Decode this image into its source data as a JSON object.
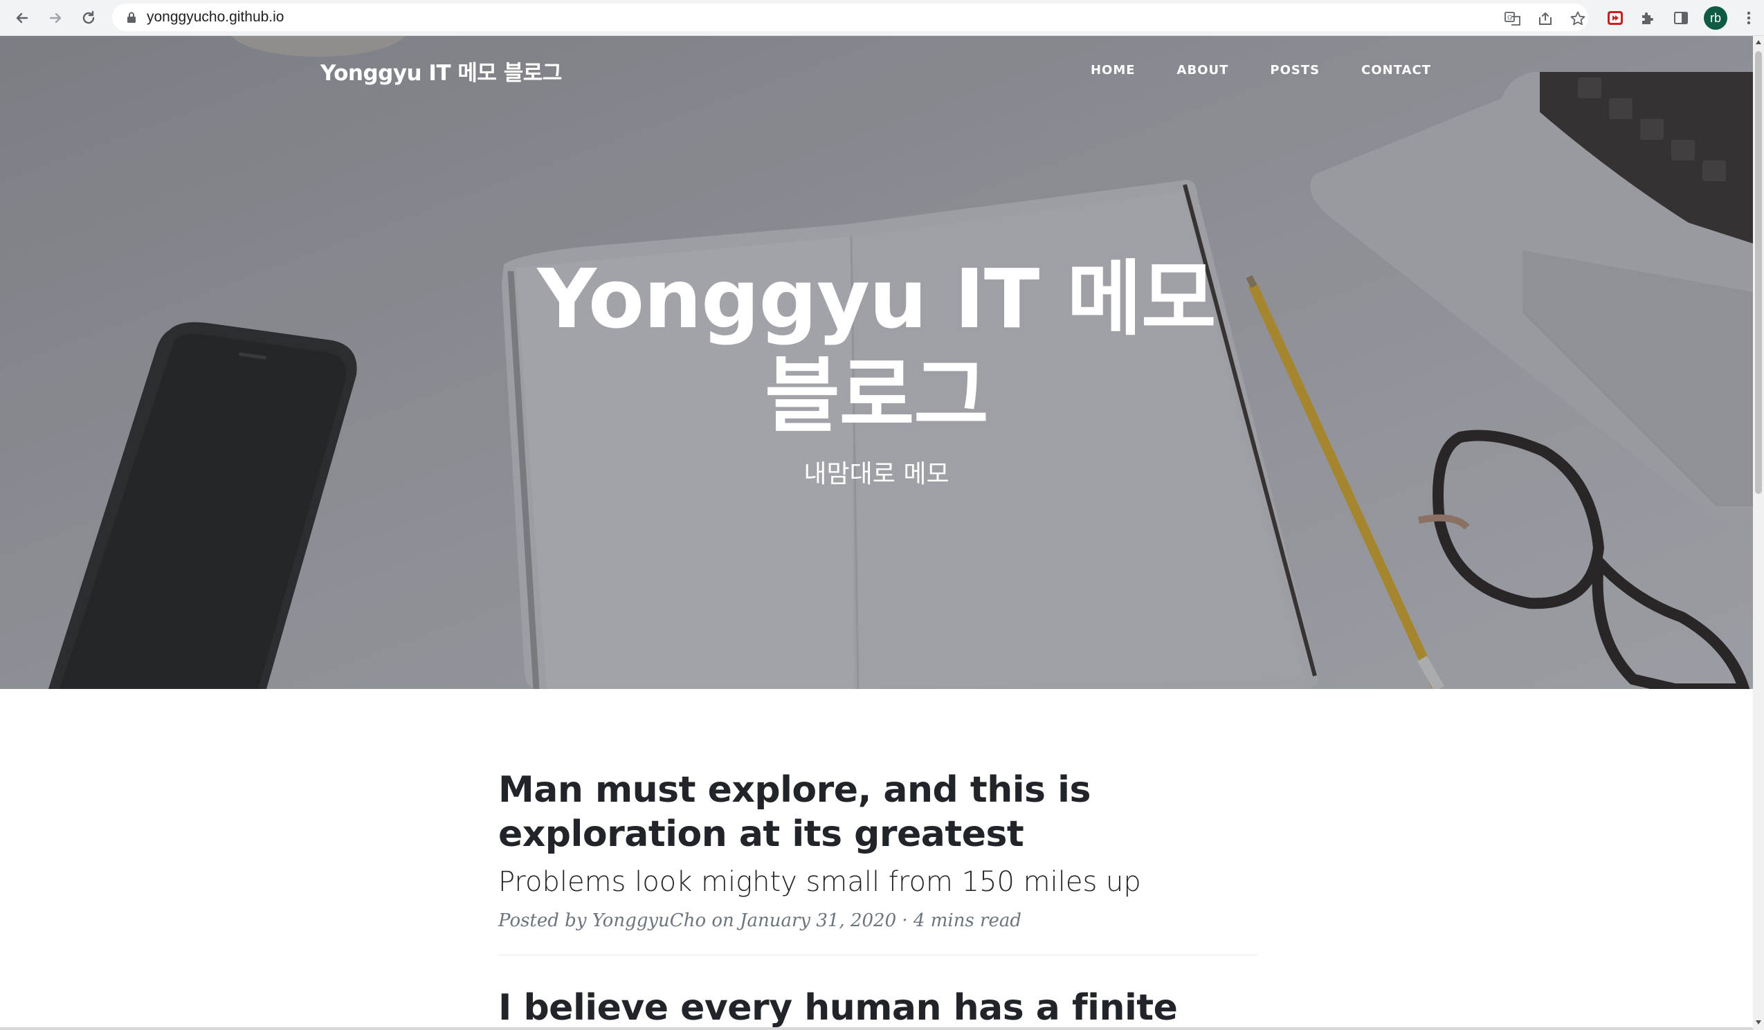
{
  "browser": {
    "url": "yonggyucho.github.io",
    "profile_initials": "rb"
  },
  "site": {
    "brand": "Yonggyu IT 메모 블로그",
    "nav": [
      "HOME",
      "ABOUT",
      "POSTS",
      "CONTACT"
    ],
    "hero_title": "Yonggyu IT 메모 블로그",
    "hero_subtitle": "내맘대로 메모"
  },
  "posts": [
    {
      "title": "Man must explore, and this is exploration at its greatest",
      "subtitle": "Problems look mighty small from 150 miles up",
      "meta_prefix": "Posted by",
      "author": "YonggyuCho",
      "meta_date": "on January 31, 2020",
      "read_time": "· 4 mins read"
    },
    {
      "title": "I believe every human has a finite"
    }
  ]
}
